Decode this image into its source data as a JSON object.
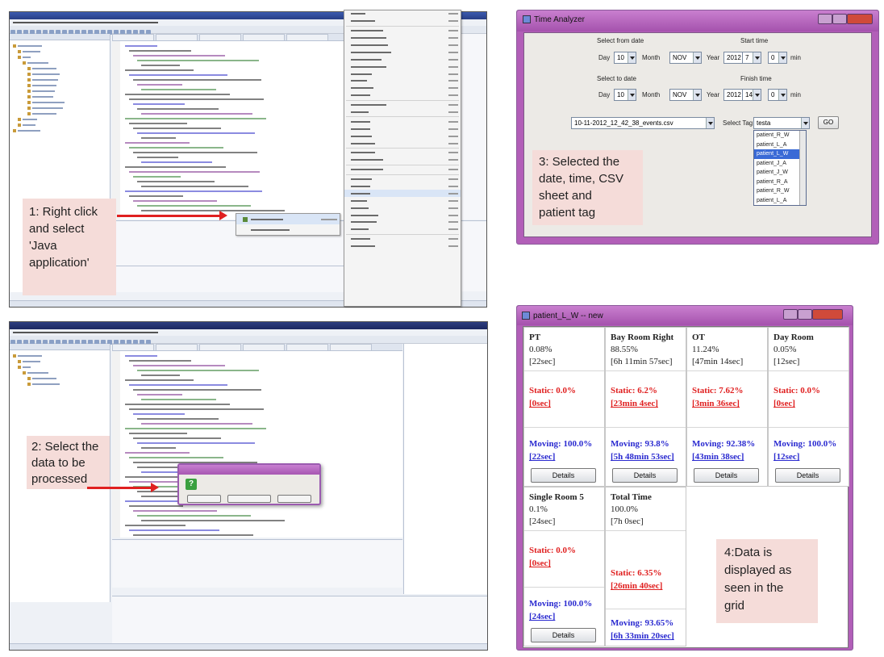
{
  "callouts": {
    "step1": "1: Right click\nand select\n'Java\napplication'",
    "step2": "2: Select the\ndata to be\nprocessed",
    "step3": "3: Selected the\ndate, time, CSV\nsheet and\npatient tag",
    "step4": "4:Data is\ndisplayed as\nseen in the\ngrid"
  },
  "colors": {
    "callout_bg": "#f5dcd9",
    "arrow": "#e02020",
    "static_text": "#e02020",
    "moving_text": "#2a2ad0",
    "window_frame": "#b25fb8"
  },
  "eclipse_top": {
    "icon": "eclipse-icon",
    "context_item": "Java Application",
    "context_item_2": "Run Configurations..."
  },
  "eclipse_bottom": {
    "dialog_icon": "question-icon"
  },
  "time_analyzer": {
    "title": "Time Analyzer",
    "start_date_label": "Select from date",
    "start_time_label": "Start time",
    "to_date_label": "Select to date",
    "finish_time_label": "Finish time",
    "day_label": "Day",
    "month_label": "Month",
    "year_label": "Year",
    "min_label": "min",
    "from": {
      "day": "10",
      "month": "NOV",
      "year": "2012",
      "hour": "7",
      "min": "0"
    },
    "to": {
      "day": "10",
      "month": "NOV",
      "year": "2012",
      "hour": "14",
      "min": "0"
    },
    "csv_file": "10-11-2012_12_42_38_events.csv",
    "select_tag_label": "Select Tag",
    "select_tag_value": "testa",
    "go_label": "GO",
    "tag_options": [
      "patient_R_W",
      "patient_L_A",
      "patient_L_W",
      "patient_J_A",
      "patient_J_W",
      "patient_R_A",
      "patient_R_W",
      "patient_L_A"
    ],
    "selected_index": 2
  },
  "grid_window": {
    "title": "patient_L_W -- new",
    "details_label": "Details",
    "cells": [
      {
        "name": "PT",
        "pct": "0.08%",
        "time": "[22sec]",
        "static": "Static: 0.0%",
        "static_time": "[0sec]",
        "moving": "Moving: 100.0%",
        "moving_time": "[22sec]"
      },
      {
        "name": "Bay Room Right",
        "pct": "88.55%",
        "time": "[6h 11min 57sec]",
        "static": "Static: 6.2%",
        "static_time": "[23min 4sec]",
        "moving": "Moving: 93.8%",
        "moving_time": "[5h 48min 53sec]"
      },
      {
        "name": "OT",
        "pct": "11.24%",
        "time": "[47min 14sec]",
        "static": "Static: 7.62%",
        "static_time": "[3min 36sec]",
        "moving": "Moving: 92.38%",
        "moving_time": "[43min 38sec]"
      },
      {
        "name": "Day Room",
        "pct": "0.05%",
        "time": "[12sec]",
        "static": "Static: 0.0%",
        "static_time": "[0sec]",
        "moving": "Moving: 100.0%",
        "moving_time": "[12sec]"
      },
      {
        "name": "Single Room 5",
        "pct": "0.1%",
        "time": "[24sec]",
        "static": "Static: 0.0%",
        "static_time": "[0sec]",
        "moving": "Moving: 100.0%",
        "moving_time": "[24sec]"
      }
    ],
    "total": {
      "name": "Total Time",
      "pct": "100.0%",
      "time": "[7h 0sec]",
      "static": "Static: 6.35%",
      "static_time": "[26min 40sec]",
      "moving": "Moving: 93.65%",
      "moving_time": "[6h 33min 20sec]"
    }
  }
}
